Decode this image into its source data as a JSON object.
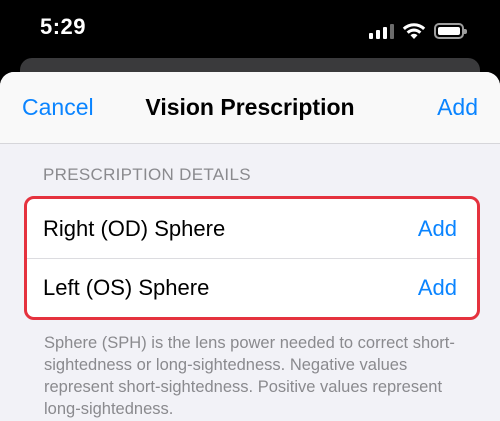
{
  "status": {
    "time": "5:29"
  },
  "nav": {
    "cancel_label": "Cancel",
    "title": "Vision Prescription",
    "add_label": "Add"
  },
  "section": {
    "header": "PRESCRIPTION DETAILS",
    "rows": [
      {
        "label": "Right (OD) Sphere",
        "action": "Add"
      },
      {
        "label": "Left (OS) Sphere",
        "action": "Add"
      }
    ],
    "footer": "Sphere (SPH) is the lens power needed to correct short-sightedness or long-sightedness. Negative values represent short-sightedness. Positive values represent long-sightedness."
  },
  "colors": {
    "accent": "#0a84ff",
    "highlight_border": "#e5323e",
    "secondary_text": "#8a8a8e",
    "background": "#f2f2f7"
  },
  "icons": [
    "signal-icon",
    "wifi-icon",
    "battery-icon"
  ]
}
